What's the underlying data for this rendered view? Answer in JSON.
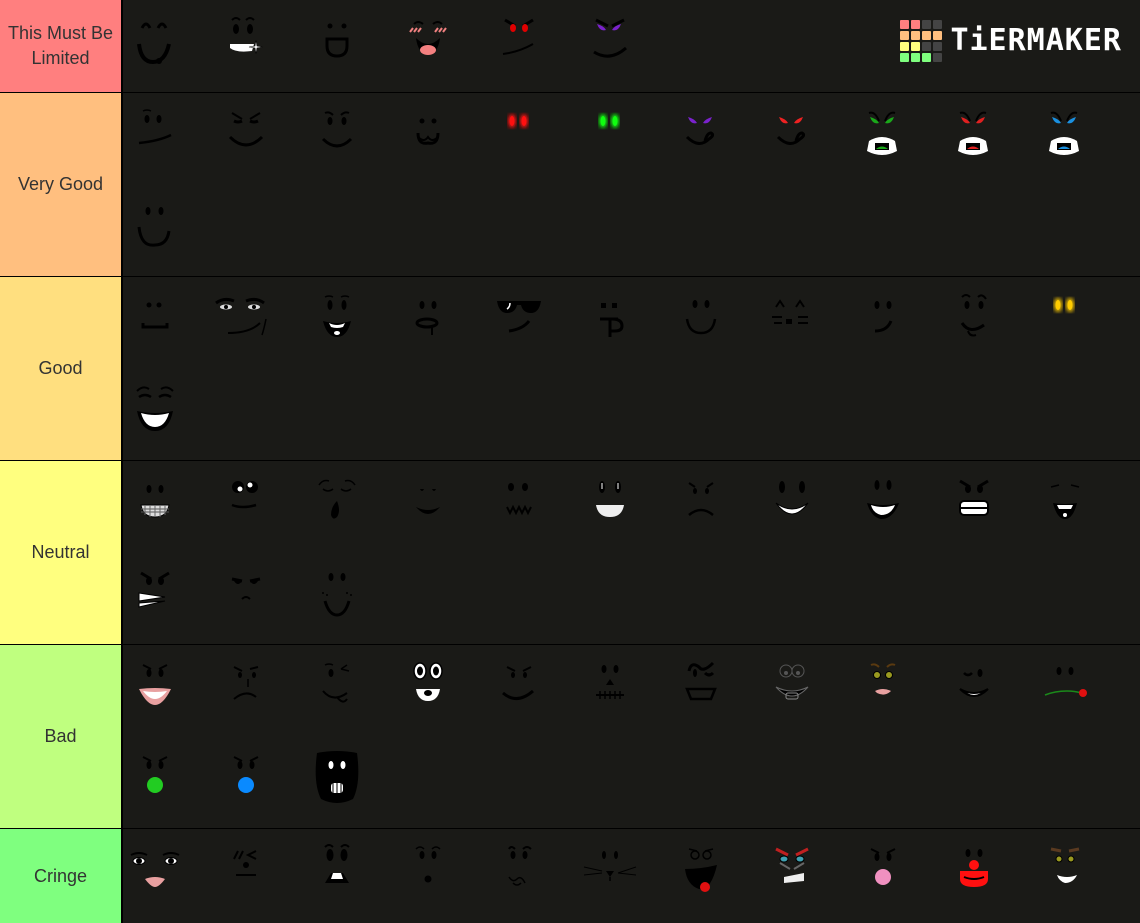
{
  "logo": {
    "text": "TiERMAKER",
    "grid_colors": [
      "#ff7f7f",
      "#ff7f7f",
      "#444444",
      "#444444",
      "#ffbf7f",
      "#ffbf7f",
      "#ffbf7f",
      "#ffbf7f",
      "#ffff7f",
      "#ffff7f",
      "#444444",
      "#444444",
      "#7fff7f",
      "#7fff7f",
      "#7fff7f",
      "#444444"
    ]
  },
  "colors": {
    "row_background": "#1a1a17",
    "separator": "#000000",
    "label_text": "#333333"
  },
  "tiers": [
    {
      "label": "This Must Be Limited",
      "color": "#ff7f7f",
      "faces": [
        "happy-closed-eyes",
        "sparkle-grin",
        "open-d-smile",
        "blush-tongue",
        "red-eyes-smirk",
        "purple-eyes-smirk"
      ]
    },
    {
      "label": "Very Good",
      "color": "#ffbf7f",
      "faces": [
        "smirk",
        "sly-smile",
        "confident-smile",
        "cat-mouth-w",
        "glowing-red-eyes",
        "glowing-green-eyes",
        "purple-eyes-tongue",
        "red-eyes-tongue",
        "green-fangs",
        "red-fangs",
        "blue-fangs",
        "simple-smile"
      ]
    },
    {
      "label": "Good",
      "color": "#ffdf7f",
      "faces": [
        "flat-mouth",
        "man-face",
        "laughing-smile",
        "drooling",
        "cool-shades",
        "tongue-p",
        "classic-smile",
        "kitty-face",
        "side-smirk",
        "tongue-smile",
        "glowing-yellow-eyes",
        "big-grin"
      ]
    },
    {
      "label": "Neutral",
      "color": "#ffff7f",
      "faces": [
        "braces-grin",
        "googly-eyes",
        "sleepy-yawn",
        "small-smile",
        "zigzag-mouth",
        "shiny-grin",
        "frown",
        "toothy-smile",
        "white-grin",
        "angry-teeth",
        "squint-laugh",
        "grimace",
        "unimpressed",
        "freckle-smile"
      ]
    },
    {
      "label": "Bad",
      "color": "#bfff7f",
      "faces": [
        "lipstick-smile",
        "skeptical",
        "silly-wink",
        "cartoon-eyes",
        "wide-smirk",
        "stitched-mouth",
        "wink-bucket",
        "outline-grin",
        "green-eyed-lips",
        "wink-smile",
        "rose-mouth",
        "green-bubblegum",
        "blue-bubblegum",
        "zombie"
      ]
    },
    {
      "label": "Cringe",
      "color": "#7fff7f",
      "faces": [
        "makeup-face",
        "emoticon-wink",
        "shocked-mouth",
        "surprised-o",
        "scribble-mouth",
        "whiskers",
        "tongue-out-red",
        "evil-grin",
        "pink-bubblegum",
        "clown-nose",
        "green-eyed-grin"
      ]
    }
  ]
}
